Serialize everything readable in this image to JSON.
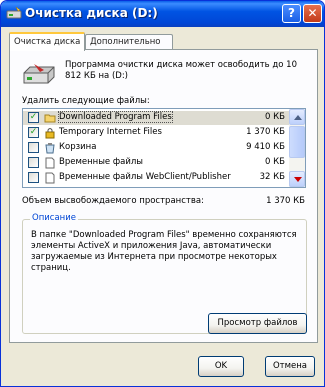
{
  "window": {
    "title": "Очистка диска  (D:)",
    "help_label": "?",
    "close_label": "✕"
  },
  "tabs": [
    {
      "label": "Очистка диска",
      "active": true
    },
    {
      "label": "Дополнительно",
      "active": false
    }
  ],
  "intro_text": "Программа очистки диска может освободить до 10 812 КБ на (D:)",
  "files_label": "Удалить следующие файлы:",
  "files": [
    {
      "name": "Downloaded Program Files",
      "size": "0 КБ",
      "checked": true,
      "icon": "folder-icon",
      "selected": true
    },
    {
      "name": "Temporary Internet Files",
      "size": "1 370 КБ",
      "checked": true,
      "icon": "lock-icon",
      "selected": false
    },
    {
      "name": "Корзина",
      "size": "9 410 КБ",
      "checked": false,
      "icon": "recycle-bin-icon",
      "selected": false
    },
    {
      "name": "Временные файлы",
      "size": "0 КБ",
      "checked": false,
      "icon": "document-icon",
      "selected": false
    },
    {
      "name": "Временные файлы WebClient/Publisher",
      "size": "32 КБ",
      "checked": false,
      "icon": "document-icon",
      "selected": false
    },
    {
      "name": "",
      "size": "",
      "checked": false,
      "icon": "document-icon",
      "selected": false
    }
  ],
  "total_label": "Объем высвобождаемого пространства:",
  "total_value": "1 370 КБ",
  "description": {
    "title": "Описание",
    "text": "В папке \"Downloaded Program Files\" временно сохраняются элементы ActiveX и приложения Java, автоматически загружаемые из Интернета при просмотре некоторых страниц.",
    "view_button": "Просмотр файлов"
  },
  "buttons": {
    "ok": "OK",
    "cancel": "Отмена"
  },
  "colors": {
    "titlebar": "#0054e3",
    "window_bg": "#ece9d8",
    "panel_bg": "#fcfcfe",
    "group_title": "#0046d5"
  }
}
